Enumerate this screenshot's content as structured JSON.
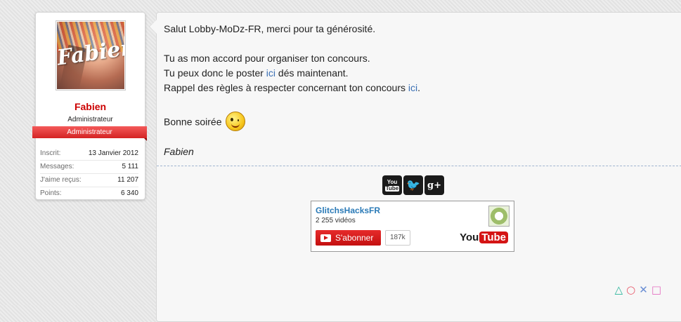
{
  "user": {
    "avatar_text": "Fabien",
    "name": "Fabien",
    "title": "Administrateur",
    "banner": "Administrateur",
    "stats": [
      {
        "label": "Inscrit:",
        "value": "13 Janvier 2012"
      },
      {
        "label": "Messages:",
        "value": "5 111"
      },
      {
        "label": "J'aime reçus:",
        "value": "11 207"
      },
      {
        "label": "Points:",
        "value": "6 340"
      }
    ]
  },
  "message": {
    "greeting": "Salut Lobby-MoDz-FR, merci pour ta générosité.",
    "line_accord": "Tu as mon accord pour organiser ton concours.",
    "line_post_before": "Tu peux donc le poster ",
    "line_post_link": "ici",
    "line_post_after": " dés maintenant.",
    "line_rules_before": "Rappel des règles à respecter concernant ton concours ",
    "line_rules_link": "ici",
    "line_rules_after": ".",
    "closing": "Bonne soirée",
    "signature": "Fabien"
  },
  "signature_block": {
    "social": {
      "youtube_top": "You",
      "youtube_bottom": "Tube",
      "twitter_glyph": "🐦",
      "googleplus_glyph": "g+"
    },
    "youtube_widget": {
      "channel_name": "GlitchsHacksFR",
      "video_count": "2 255 vidéos",
      "subscribe_label": "S'abonner",
      "subscriber_count": "187k",
      "logo_you": "You",
      "logo_tube": "Tube"
    }
  },
  "ps_symbols": [
    "△",
    "○",
    "✕",
    "□"
  ]
}
